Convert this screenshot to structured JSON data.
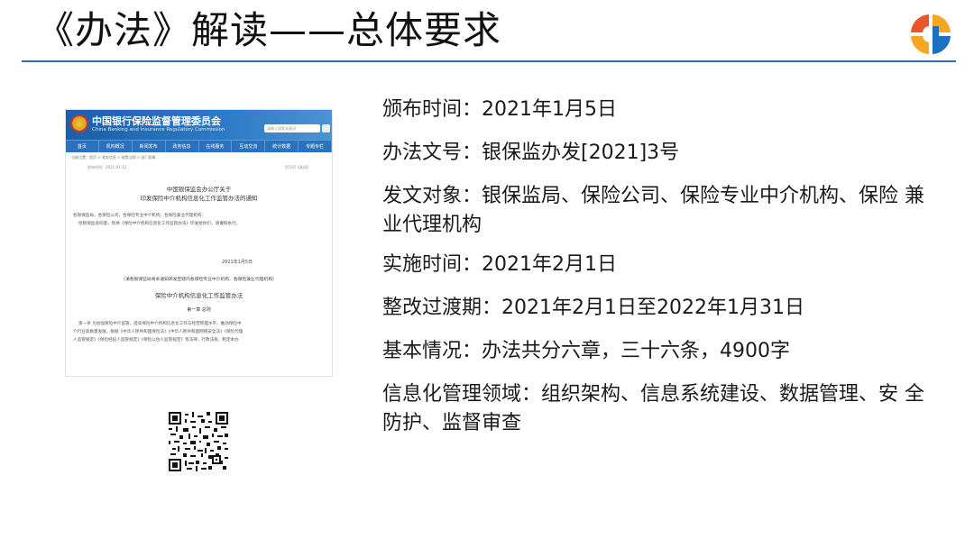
{
  "slide": {
    "title": "《办法》解读——总体要求"
  },
  "document": {
    "org_name_cn": "中国银行保险监督管理委员会",
    "org_name_en": "China Banking and Insurance Regulatory Commission",
    "search_placeholder": "请输入搜索关键词",
    "nav": [
      "首页",
      "机构概况",
      "新闻发布",
      "政务信息",
      "在线服务",
      "互动交流",
      "统计数据",
      "专题专栏"
    ],
    "breadcrumb": "当前位置：首页 > 政务信息 > 政策法规 > 部门规章",
    "meta_left": "发布时间：2021-01-12",
    "meta_right": "【打印】【关闭】",
    "heading_1": "中国银保监会办公厅关于",
    "heading_2": "印发保险中介机构信息化工作监管办法的通知",
    "para_1": "各银保监局，各保险公司，各保险专业中介机构，各保险兼业代理机构：",
    "para_2": "经银保监会同意，现将《保险中介机构信息化工作监管办法》印发给你们，请遵照执行。",
    "date": "2021年1月5日",
    "note": "（请各银保监局将本通知转发至辖内各保险专业中介机构、各保险兼业代理机构）",
    "law_title": "保险中介机构信息化工作监管办法",
    "chapter": "第一章 总则",
    "para_3": "第一条 为加强保险中介监管，提高保险中介机构信息化工作与经营管理水平，推动保险中",
    "para_4": "介行业高质量发展，根据《中华人民共和国保险法》《中华人民共和国网络安全法》《保险代理",
    "para_5": "人监管规定》《保险经纪人监管规定》《保险公估人监管规定》等法律、行政法规，制定本办"
  },
  "info": {
    "items": [
      "颁布时间：2021年1月5日",
      "办法文号：银保监办发[2021]3号",
      "发文对象：银保监局、保险公司、保险专业中介机构、保险 兼业代理机构",
      "实施时间：2021年2月1日",
      "整改过渡期：2021年2月1日至2022年1月31日",
      "基本情况：办法共分六章，三十六条，4900字",
      "信息化管理领域：组织架构、信息系统建设、数据管理、安 全防护、监督审查"
    ]
  },
  "colors": {
    "accent": "#2e6fb5",
    "logo_orange": "#e8562a",
    "logo_blue": "#1d6fc2"
  }
}
